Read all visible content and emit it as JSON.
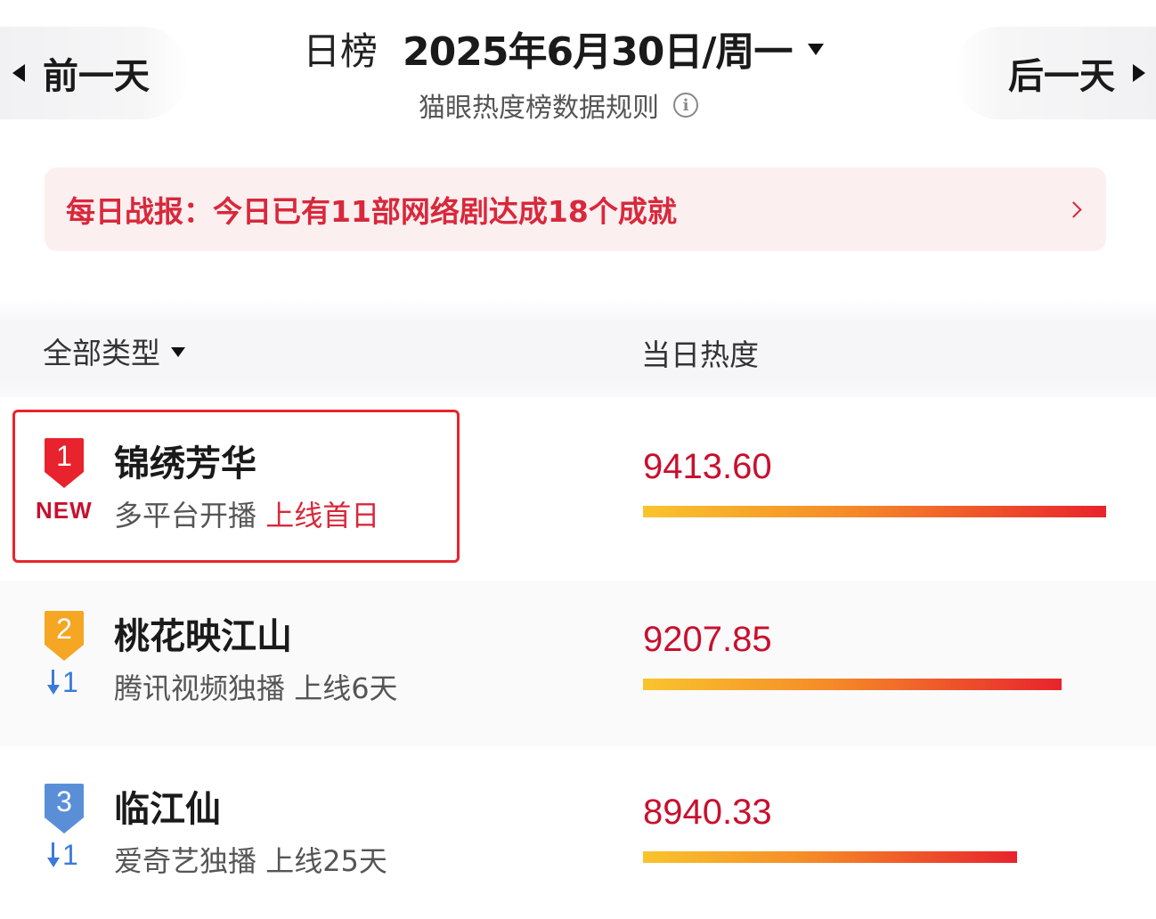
{
  "header": {
    "prev_label": "前一天",
    "next_label": "后一天",
    "title_label": "日榜",
    "date": "2025年6月30日/周一",
    "rules_text": "猫眼热度榜数据规则"
  },
  "banner": {
    "text": "每日战报：今日已有11部网络剧达成18个成就"
  },
  "columns": {
    "type_filter": "全部类型",
    "heat_label": "当日热度"
  },
  "rows": [
    {
      "rank": "1",
      "title": "锦绣芳华",
      "change": "NEW",
      "platform": "多平台开播",
      "release": "上线首日",
      "heat": "9413.60",
      "heat_fraction": 1.0,
      "badge_color": "#e8232d"
    },
    {
      "rank": "2",
      "title": "桃花映江山",
      "change": "1",
      "platform": "腾讯视频独播",
      "release": "上线6天",
      "heat": "9207.85",
      "heat_fraction": 0.903,
      "badge_color": "#f5a623"
    },
    {
      "rank": "3",
      "title": "临江仙",
      "change": "1",
      "platform": "爱奇艺独播",
      "release": "上线25天",
      "heat": "8940.33",
      "heat_fraction": 0.808,
      "badge_color": "#5a8fd8"
    }
  ],
  "colors": {
    "accent_red": "#d9283b",
    "rank_up_down_blue": "#3b7bd8"
  }
}
